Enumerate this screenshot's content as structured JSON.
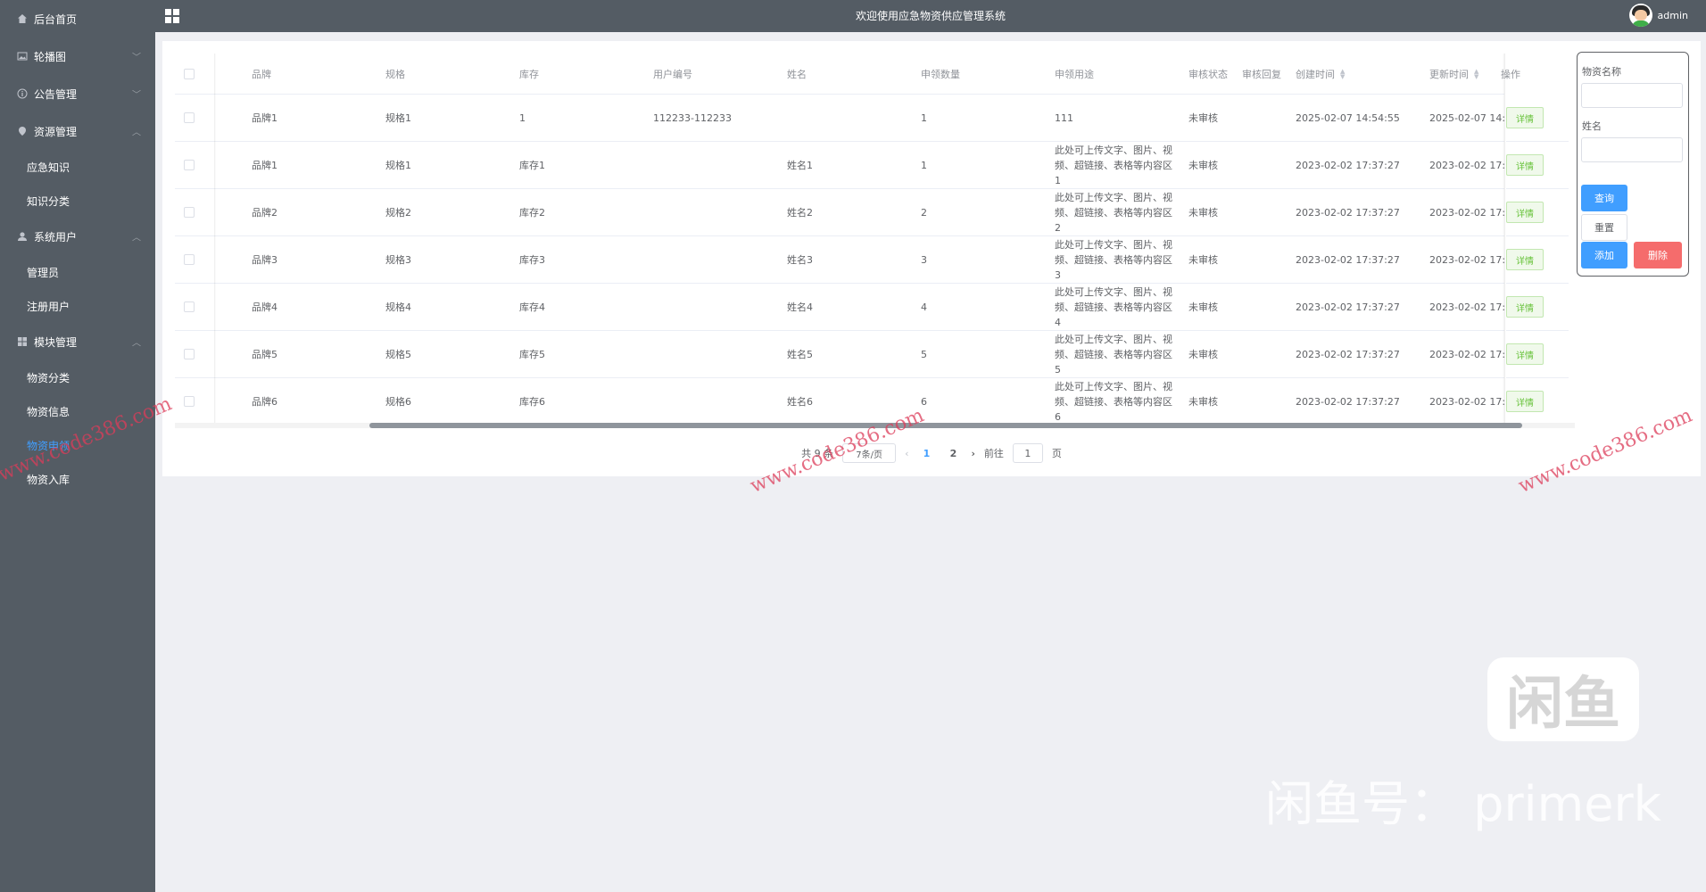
{
  "app": {
    "title": "欢迎使用应急物资供应管理系统",
    "user": "admin"
  },
  "sidebar": {
    "items": [
      {
        "label": "后台首页",
        "icon": "home-icon",
        "children": []
      },
      {
        "label": "轮播图",
        "icon": "image-icon",
        "children": []
      },
      {
        "label": "公告管理",
        "icon": "info-icon",
        "children": []
      },
      {
        "label": "资源管理",
        "icon": "location-icon",
        "children": [
          "应急知识",
          "知识分类"
        ]
      },
      {
        "label": "系统用户",
        "icon": "user-icon",
        "children": [
          "管理员",
          "注册用户"
        ]
      },
      {
        "label": "模块管理",
        "icon": "grid-icon",
        "children": [
          "物资分类",
          "物资信息",
          "物资申领",
          "物资入库"
        ]
      }
    ],
    "active": "物资申领"
  },
  "table": {
    "headers": [
      "品牌",
      "规格",
      "库存",
      "用户编号",
      "姓名",
      "申领数量",
      "申领用途",
      "审核状态",
      "审核回复",
      "创建时间",
      "更新时间",
      "操作"
    ],
    "detail_label": "详情",
    "rows": [
      {
        "brand": "品牌1",
        "spec": "规格1",
        "stock": "1",
        "user_no": "112233-112233",
        "name": "",
        "qty": "1",
        "purpose": "111",
        "status": "未审核",
        "reply": "",
        "created": "2025-02-07 14:54:55",
        "updated": "2025-02-07 14:"
      },
      {
        "brand": "品牌1",
        "spec": "规格1",
        "stock": "库存1",
        "user_no": "",
        "name": "姓名1",
        "qty": "1",
        "purpose": "此处可上传文字、图片、视频、超链接、表格等内容区1",
        "status": "未审核",
        "reply": "",
        "created": "2023-02-02 17:37:27",
        "updated": "2023-02-02 17:"
      },
      {
        "brand": "品牌2",
        "spec": "规格2",
        "stock": "库存2",
        "user_no": "",
        "name": "姓名2",
        "qty": "2",
        "purpose": "此处可上传文字、图片、视频、超链接、表格等内容区2",
        "status": "未审核",
        "reply": "",
        "created": "2023-02-02 17:37:27",
        "updated": "2023-02-02 17:"
      },
      {
        "brand": "品牌3",
        "spec": "规格3",
        "stock": "库存3",
        "user_no": "",
        "name": "姓名3",
        "qty": "3",
        "purpose": "此处可上传文字、图片、视频、超链接、表格等内容区3",
        "status": "未审核",
        "reply": "",
        "created": "2023-02-02 17:37:27",
        "updated": "2023-02-02 17:"
      },
      {
        "brand": "品牌4",
        "spec": "规格4",
        "stock": "库存4",
        "user_no": "",
        "name": "姓名4",
        "qty": "4",
        "purpose": "此处可上传文字、图片、视频、超链接、表格等内容区4",
        "status": "未审核",
        "reply": "",
        "created": "2023-02-02 17:37:27",
        "updated": "2023-02-02 17:"
      },
      {
        "brand": "品牌5",
        "spec": "规格5",
        "stock": "库存5",
        "user_no": "",
        "name": "姓名5",
        "qty": "5",
        "purpose": "此处可上传文字、图片、视频、超链接、表格等内容区5",
        "status": "未审核",
        "reply": "",
        "created": "2023-02-02 17:37:27",
        "updated": "2023-02-02 17:"
      },
      {
        "brand": "品牌6",
        "spec": "规格6",
        "stock": "库存6",
        "user_no": "",
        "name": "姓名6",
        "qty": "6",
        "purpose": "此处可上传文字、图片、视频、超链接、表格等内容区6",
        "status": "未审核",
        "reply": "",
        "created": "2023-02-02 17:37:27",
        "updated": "2023-02-02 17:"
      }
    ]
  },
  "pagination": {
    "total": "共 9 条",
    "page_size": "7条/页",
    "pages": [
      "1",
      "2"
    ],
    "current": "1",
    "goto_label": "前往",
    "goto_value": "1",
    "page_suffix": "页"
  },
  "search": {
    "field1_label": "物资名称",
    "field2_label": "姓名",
    "query_label": "查询",
    "reset_label": "重置",
    "add_label": "添加",
    "delete_label": "删除"
  },
  "watermark": {
    "site": "www.code386.com",
    "logo": "闲鱼",
    "text": "闲鱼号： primerk"
  }
}
